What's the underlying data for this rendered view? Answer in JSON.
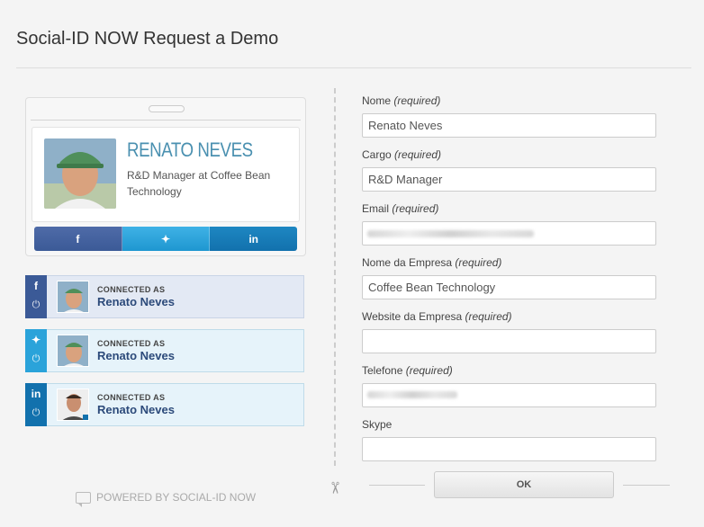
{
  "page": {
    "title": "Social-ID NOW Request a Demo"
  },
  "profile": {
    "name": "RENATO NEVES",
    "role": "R&D Manager at Coffee Bean Technology",
    "share": [
      {
        "network": "facebook",
        "glyph": "f"
      },
      {
        "network": "twitter",
        "glyph": "✦"
      },
      {
        "network": "linkedin",
        "glyph": "in"
      }
    ]
  },
  "connections": [
    {
      "network": "facebook",
      "glyph": "f",
      "label": "CONNECTED AS",
      "name": "Renato Neves"
    },
    {
      "network": "twitter",
      "glyph": "✦",
      "label": "CONNECTED AS",
      "name": "Renato Neves"
    },
    {
      "network": "linkedin",
      "glyph": "in",
      "label": "CONNECTED AS",
      "name": "Renato Neves"
    }
  ],
  "footer": {
    "powered": "POWERED BY SOCIAL-ID NOW"
  },
  "form": {
    "fields": [
      {
        "label": "Nome",
        "hint": "(required)",
        "value": "Renato Neves"
      },
      {
        "label": "Cargo",
        "hint": "(required)",
        "value": "R&D Manager"
      },
      {
        "label": "Email",
        "hint": "(required)",
        "value": ""
      },
      {
        "label": "Nome da Empresa",
        "hint": "(required)",
        "value": "Coffee Bean Technology"
      },
      {
        "label": "Website da Empresa",
        "hint": "(required)",
        "value": ""
      },
      {
        "label": "Telefone",
        "hint": "(required)",
        "value": ""
      },
      {
        "label": "Skype",
        "hint": "",
        "value": ""
      }
    ],
    "submit_label": "OK"
  },
  "colors": {
    "facebook": "#3b5a97",
    "twitter": "#2aa3da",
    "linkedin": "#1271ad",
    "name_accent": "#4a90b0"
  }
}
